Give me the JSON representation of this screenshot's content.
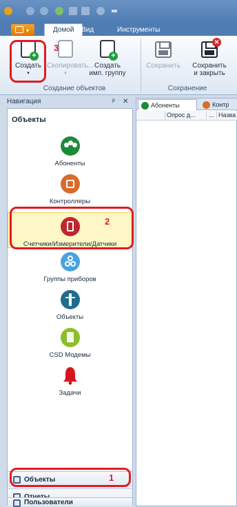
{
  "ribbon": {
    "tabs": [
      "Домой",
      "Вид",
      "Инструменты"
    ],
    "buttons": {
      "create": "Создать",
      "copy": "Скопировать...",
      "create_group_1": "Создать",
      "create_group_2": "имп. группу",
      "save": "Сохранить",
      "save_close_1": "Сохранить",
      "save_close_2": "и закрыть"
    },
    "groups": {
      "create_objects": "Создание объектов",
      "saving": "Сохранение"
    }
  },
  "navigation": {
    "header": "Навигация",
    "pin": "ᵖ",
    "close": "✕",
    "category": "Объекты",
    "items": [
      {
        "label": "Абоненты",
        "icon": "subscribers-icon",
        "color": "#1d8a3a"
      },
      {
        "label": "Контроллеры",
        "icon": "controller-icon",
        "color": "#d96b2b"
      },
      {
        "label": "Счетчики/Измерители/Датчики",
        "icon": "meter-icon",
        "color": "#c0262f"
      },
      {
        "label": "Группы приборов",
        "icon": "device-groups-icon",
        "color": "#4aa3e0"
      },
      {
        "label": "Объекты",
        "icon": "objects-icon",
        "color": "#1e6d8f"
      },
      {
        "label": "CSD Модемы",
        "icon": "modem-icon",
        "color": "#8bbf2a"
      },
      {
        "label": "Задачи",
        "icon": "bell-icon",
        "color": "#d4161e"
      }
    ],
    "bottom": [
      "Объекты",
      "Отчеты",
      "Пользователи"
    ]
  },
  "content": {
    "tabs": [
      "Абоненты",
      "Контр"
    ],
    "columns": [
      "Опрос д...",
      "...",
      "Назва"
    ]
  },
  "annotations": {
    "n1": "1",
    "n2": "2",
    "n3": "3"
  }
}
